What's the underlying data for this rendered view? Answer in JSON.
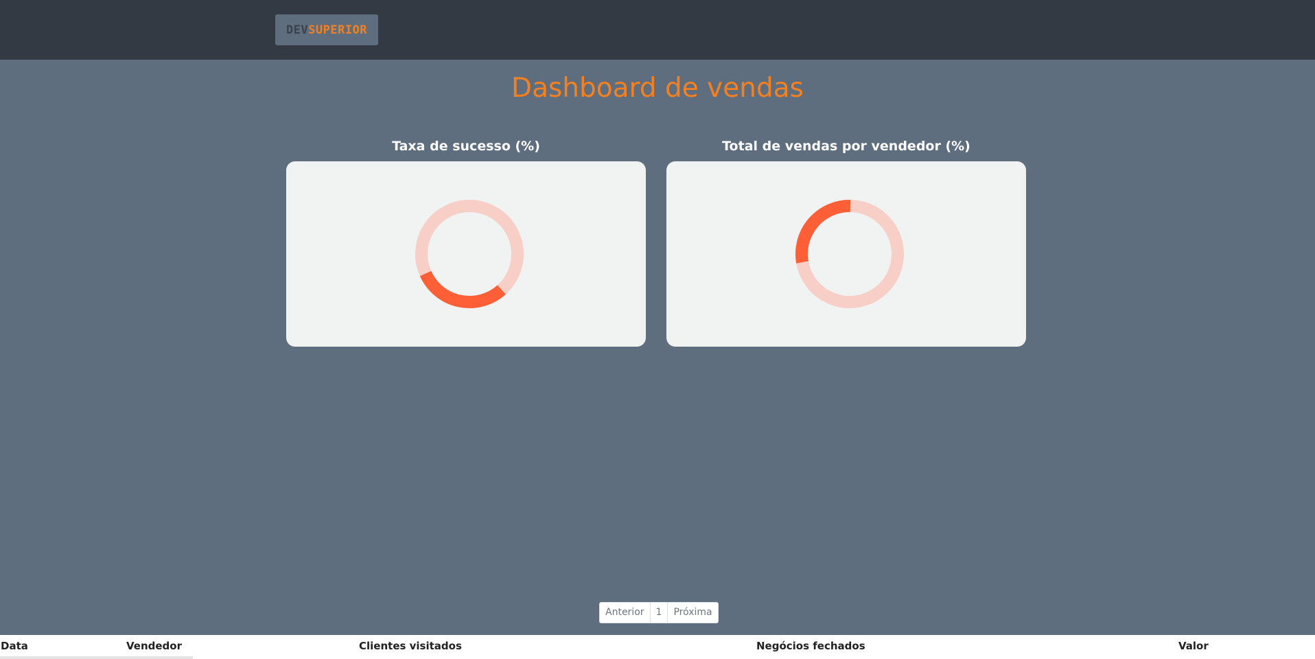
{
  "header": {
    "logo_part1": "DEV",
    "logo_part2": "SUPERIOR"
  },
  "page_title": "Dashboard de vendas",
  "chart_data": [
    {
      "type": "pie",
      "title": "Taxa de sucesso (%)",
      "slices": [
        {
          "value": 30,
          "color": "#fe5f36",
          "start_angle": 138
        },
        {
          "value": 70,
          "color": "#f7cfc6"
        }
      ]
    },
    {
      "type": "pie",
      "title": "Total de vendas por vendedor (%)",
      "slices": [
        {
          "value": 28,
          "color": "#fe5f36",
          "start_angle": 260
        },
        {
          "value": 72,
          "color": "#f7cfc6"
        }
      ]
    }
  ],
  "pagination": {
    "previous": "Anterior",
    "current": "1",
    "next": "Próxima"
  },
  "table": {
    "columns": [
      "Data",
      "Vendedor",
      "Clientes visitados",
      "Negócios fechados",
      "Valor"
    ]
  },
  "colors": {
    "accent": "#f5801f",
    "topbar": "#343a44",
    "background": "#5e6e7f",
    "donut_active": "#fe5f36",
    "donut_track": "#f7cfc6"
  }
}
